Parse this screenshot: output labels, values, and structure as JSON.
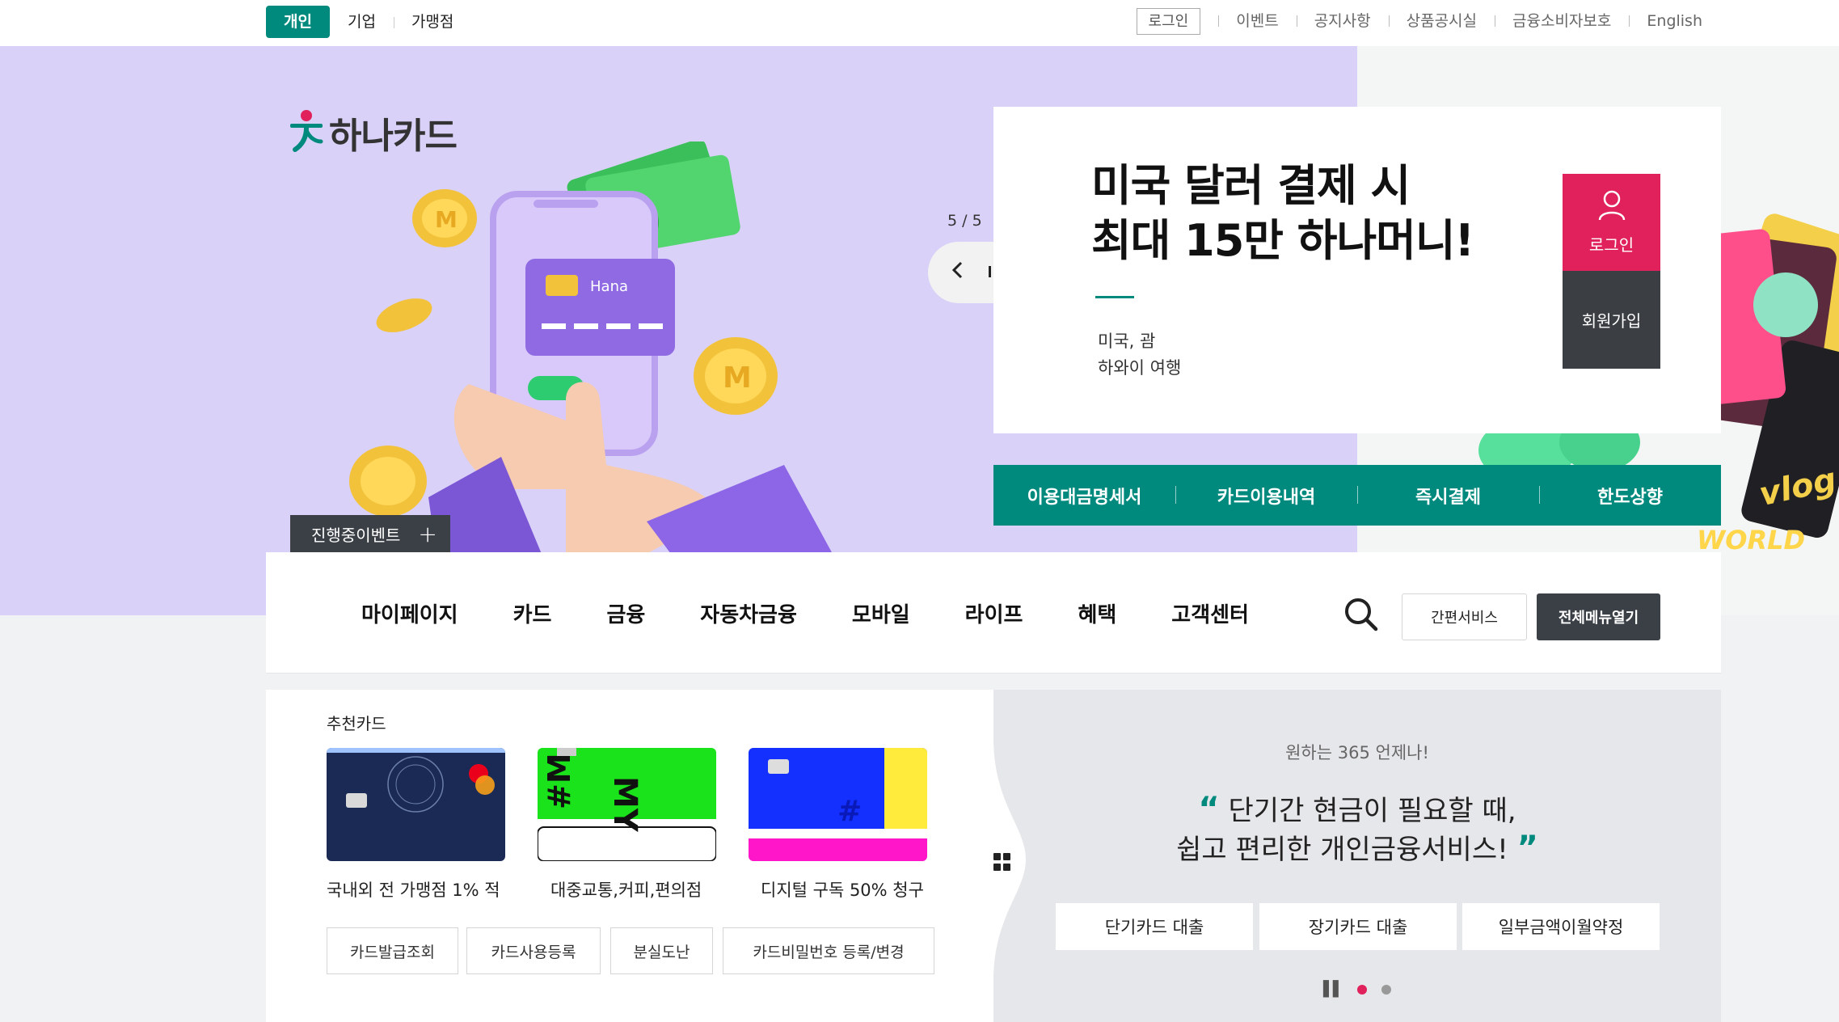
{
  "top_tabs": [
    "개인",
    "기업",
    "가맹점"
  ],
  "utility": {
    "login": "로그인",
    "links": [
      "이벤트",
      "공지사항",
      "상품공시실",
      "금융소비자보호",
      "English"
    ]
  },
  "brand": {
    "name": "하나카드"
  },
  "hero": {
    "event_button": "진행중이벤트",
    "slide_counter": "5 / 5",
    "promo_title_line1": "미국 달러 결제 시",
    "promo_title_line2": "최대 15만 하나머니!",
    "promo_sub_line1": "미국, 괌",
    "promo_sub_line2": "하와이 여행",
    "login_label": "로그인",
    "join_label": "회원가입",
    "illustration_card_brand": "Hana",
    "quick_links": [
      "이용대금명세서",
      "카드이용내역",
      "즉시결제",
      "한도상향"
    ]
  },
  "gnb": {
    "menu": [
      "마이페이지",
      "카드",
      "금융",
      "자동차금융",
      "모바일",
      "라이프",
      "혜택",
      "고객센터"
    ],
    "easy_service": "간편서비스",
    "all_menu": "전체메뉴열기"
  },
  "recommend": {
    "heading": "추천카드",
    "cards": [
      {
        "caption": "국내외 전 가맹점 1% 적"
      },
      {
        "caption": "대중교통,커피,편의점"
      },
      {
        "caption": "디지털 구독 50% 청구"
      }
    ],
    "services": [
      "카드발급조회",
      "카드사용등록",
      "분실도난",
      "카드비밀번호 등록/변경"
    ]
  },
  "loan": {
    "lead": "원하는 365 언제나!",
    "quote_line1": "단기간 현금이 필요할 때,",
    "quote_line2": "쉽고 편리한 개인금융서비스!",
    "buttons": [
      "단기카드 대출",
      "장기카드 대출",
      "일부금액이월약정"
    ]
  },
  "colors": {
    "brand_green": "#008a7e",
    "accent_pink": "#e0215b",
    "hero_purple": "#d9d1f7",
    "dark": "#3b4047"
  }
}
